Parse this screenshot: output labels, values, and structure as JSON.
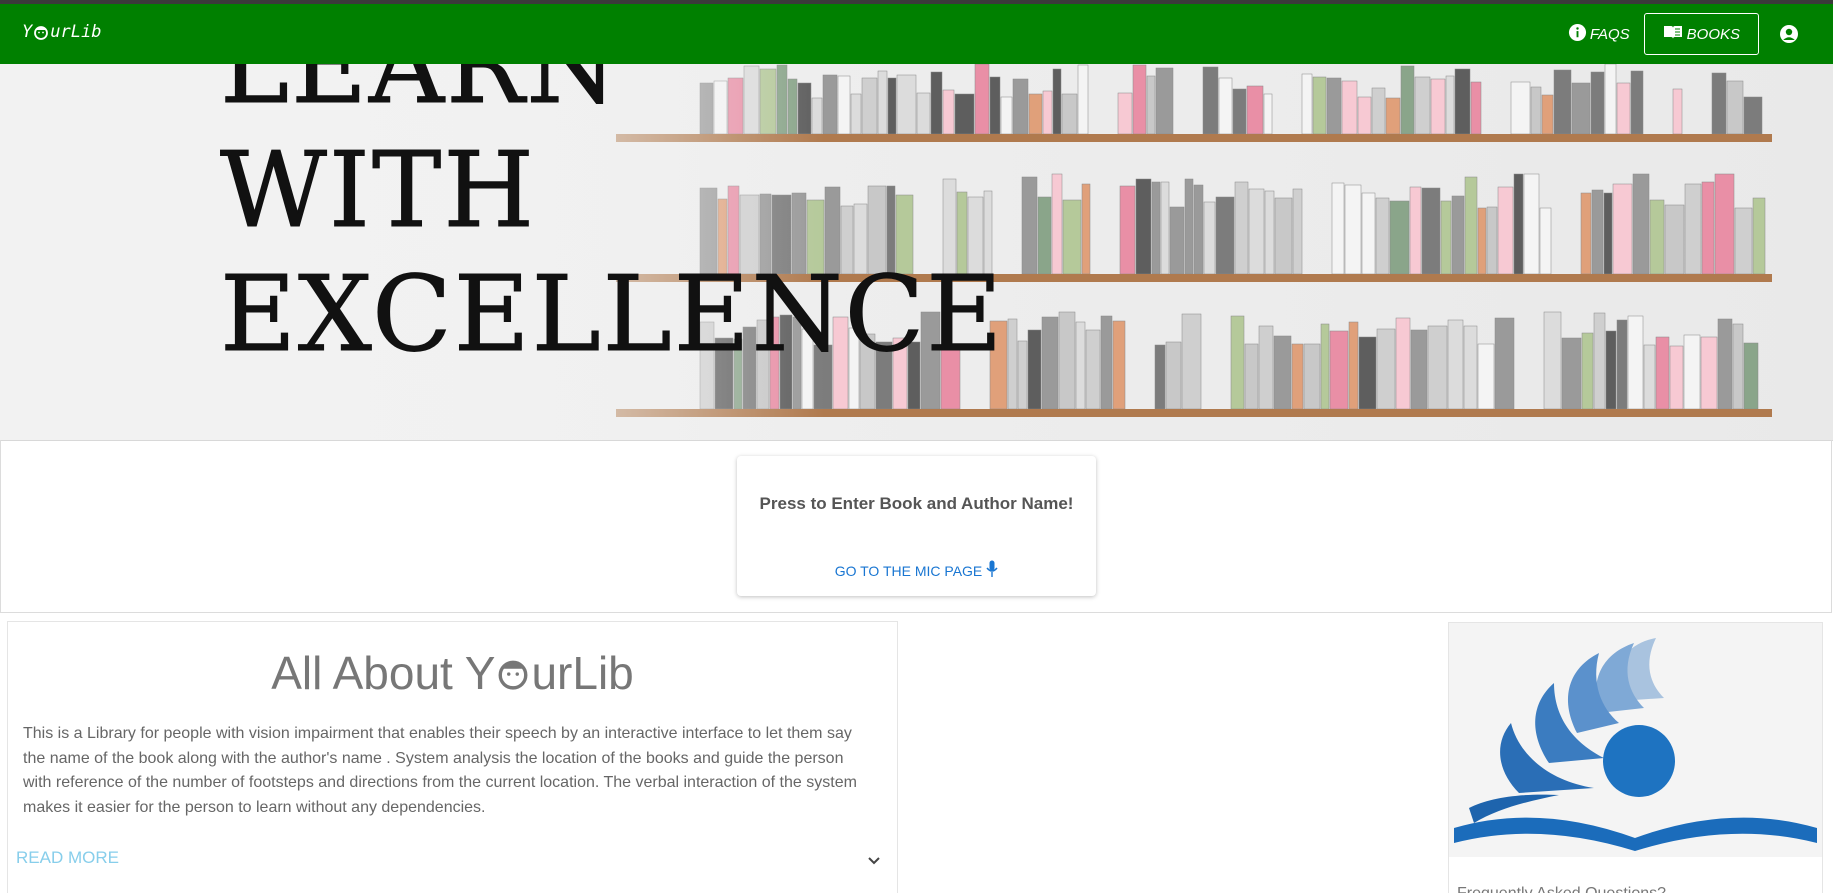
{
  "navbar": {
    "brand": {
      "prefix": "Y",
      "suffix": "urLib"
    },
    "faqs_label": "FAQS",
    "books_label": "BOOKS",
    "bg_color": "#008000"
  },
  "hero": {
    "lines": [
      "LEARN",
      "WITH",
      "EXCELLENCE"
    ]
  },
  "mic_card": {
    "title": "Press to Enter Book and Author Name!",
    "action_label": "GO TO THE MIC PAGE",
    "action_icon": "mic-icon"
  },
  "about": {
    "heading_prefix": "All About Y",
    "heading_suffix": "urLib",
    "description": "This is a Library for people with vision impairment that enables their speech by an interactive interface to let them say the name of the book along with the author's name . System analysis the location of the books and guide the person with reference of the number of footsteps and directions from the current location. The verbal interaction of the system makes it easier for the person to learn without any dependencies.",
    "read_more_label": "READ MORE",
    "expand_icon": "chevron-down-icon"
  },
  "faq_card": {
    "title": "Frequently Asked Questions?",
    "image_icon": "open-book-logo"
  }
}
